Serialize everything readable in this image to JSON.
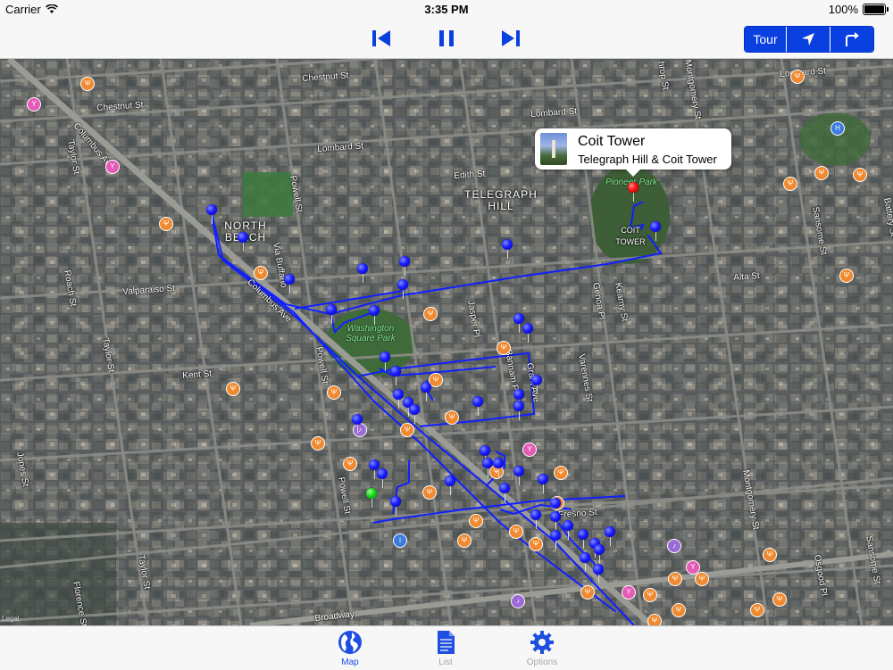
{
  "status_bar": {
    "carrier": "Carrier",
    "time": "3:35 PM",
    "battery": "100%"
  },
  "toolbar": {
    "tour_label": "Tour",
    "icons": [
      "skip-back-icon",
      "pause-icon",
      "skip-forward-icon",
      "location-arrow-icon",
      "turn-right-arrow-icon"
    ],
    "accent_color": "#0a3fe0"
  },
  "map": {
    "streets": [
      "Chestnut St",
      "Chestnut St",
      "Lombard St",
      "Lombard St",
      "Lombard St",
      "Edith St",
      "Columbus Ave",
      "Columbus Ave",
      "Taylor St",
      "Taylor St",
      "Taylor St",
      "Powell St",
      "Powell St",
      "Powell St",
      "Via Buffano",
      "Valparaiso St",
      "Roach St",
      "Kent St",
      "Jones St",
      "Jasper Pl",
      "Bannam Pl",
      "Grant Ave",
      "Varennes St",
      "Genoa Pl",
      "Kearny St",
      "Alta St",
      "Sansome St",
      "Sansome St",
      "Battery St",
      "Montgomery St",
      "Montgomery St",
      "Osgood Pl",
      "Fresno St",
      "Florence St",
      "Broadway",
      "hrop St"
    ],
    "districts": [
      "NORTH BEACH",
      "TELEGRAPH HILL",
      "COIT TOWER"
    ],
    "parks": [
      "Washington Square Park",
      "Pioneer Park"
    ],
    "legal": "Legal",
    "callout": {
      "title": "Coit Tower",
      "subtitle": "Telegraph Hill & Coit Tower"
    }
  },
  "tabbar": {
    "tabs": [
      {
        "label": "Map",
        "icon": "globe-icon",
        "active": true
      },
      {
        "label": "List",
        "icon": "document-icon",
        "active": false
      },
      {
        "label": "Options",
        "icon": "gear-icon",
        "active": false
      }
    ]
  }
}
